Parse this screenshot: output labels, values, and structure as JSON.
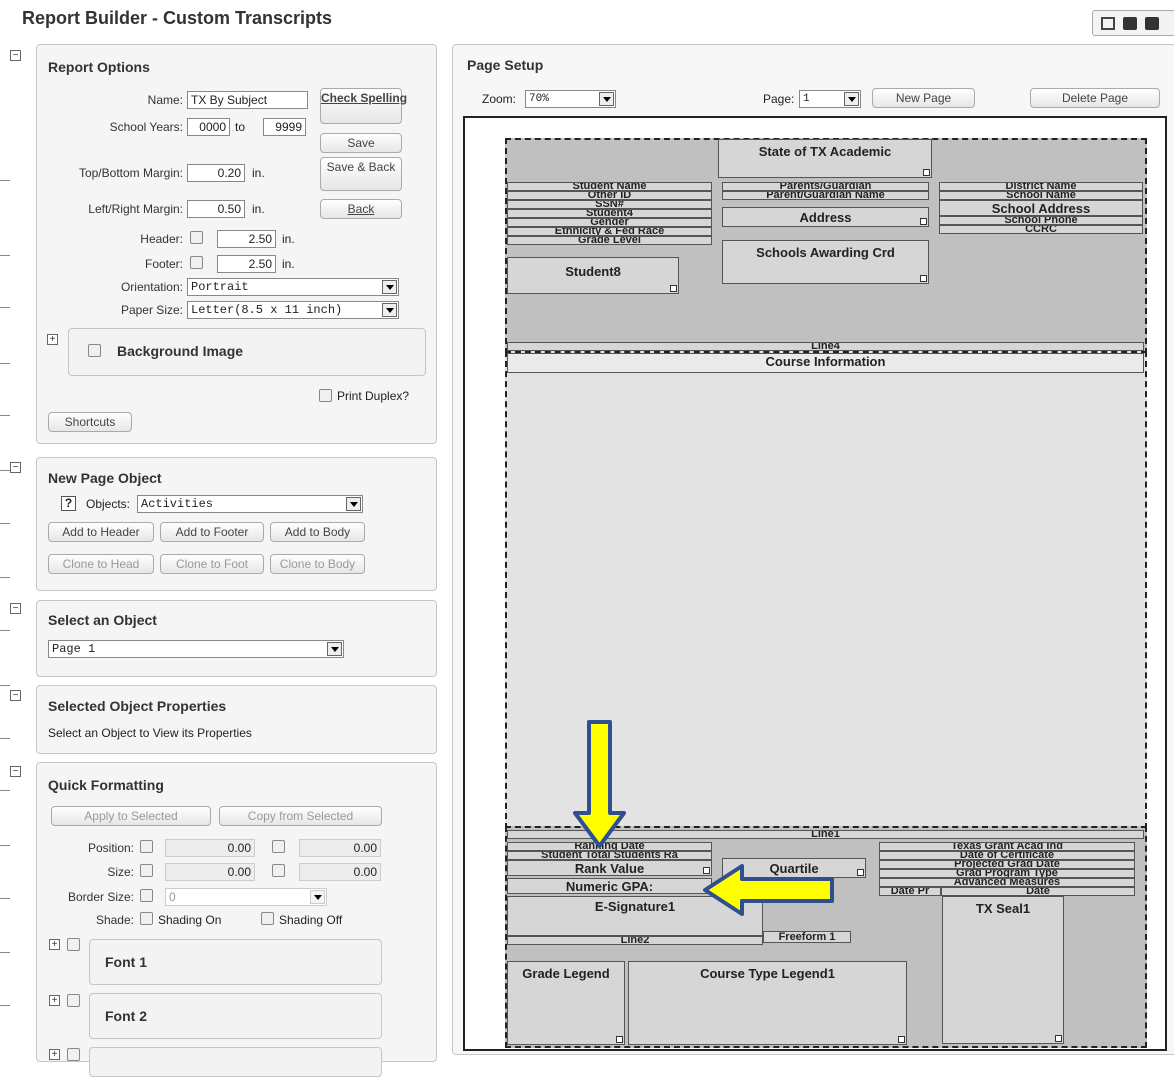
{
  "app": {
    "title": "Report Builder - Custom Transcripts"
  },
  "report_options": {
    "heading": "Report Options",
    "name_label": "Name:",
    "name_value": "TX By Subject",
    "check_spelling": "Check Spelling",
    "school_years_label": "School Years:",
    "year_from": "0000",
    "to_label": "to",
    "year_to": "9999",
    "save": "Save",
    "save_back": "Save & Back",
    "back": "Back",
    "tb_margin_label": "Top/Bottom Margin:",
    "tb_margin": "0.20",
    "lr_margin_label": "Left/Right Margin:",
    "lr_margin": "0.50",
    "in": "in.",
    "header_label": "Header:",
    "header_value": "2.50",
    "footer_label": "Footer:",
    "footer_value": "2.50",
    "orientation_label": "Orientation:",
    "orientation": "Portrait",
    "paper_label": "Paper Size:",
    "paper": "Letter(8.5 x 11 inch)",
    "background_image": "Background Image",
    "print_duplex": "Print Duplex?",
    "shortcuts": "Shortcuts"
  },
  "new_object": {
    "heading": "New Page Object",
    "help": "?",
    "objects_label": "Objects:",
    "objects_value": "Activities",
    "add_header": "Add to Header",
    "add_footer": "Add to Footer",
    "add_body": "Add to Body",
    "clone_head": "Clone to Head",
    "clone_foot": "Clone to Foot",
    "clone_body": "Clone to Body"
  },
  "select_object": {
    "heading": "Select an Object",
    "value": "Page 1"
  },
  "selected_props": {
    "heading": "Selected Object Properties",
    "text": "Select an Object to View its Properties"
  },
  "quick_format": {
    "heading": "Quick Formatting",
    "apply": "Apply to Selected",
    "copy": "Copy from Selected",
    "position_label": "Position:",
    "size_label": "Size:",
    "zero": "0.00",
    "border_label": "Border Size:",
    "border_value": "0",
    "shade_label": "Shade:",
    "shading_on": "Shading On",
    "shading_off": "Shading Off",
    "font1": "Font 1",
    "font2": "Font 2"
  },
  "page_setup": {
    "heading": "Page Setup",
    "zoom_label": "Zoom:",
    "zoom": "70%",
    "page_label": "Page:",
    "page": "1",
    "new_page": "New Page",
    "delete_page": "Delete Page"
  },
  "canvas": {
    "state": "State of TX Academic",
    "student_name": "Student Name",
    "other_id": "Other ID",
    "ssn": "SSN#",
    "student4": "Student4",
    "gender": "Gender",
    "ethnicity": "Ethnicity & Fed Race",
    "grade_level": "Grade Level",
    "parents": "Parents/Guardian",
    "parent_name": "Parent/Guardian Name",
    "address": "Address",
    "district": "District Name",
    "school_name": "School Name",
    "school_address": "School Address",
    "school_phone": "School Phone",
    "ccrc": "CCRC",
    "schools_awarding": "Schools Awarding Crd",
    "student8": "Student8",
    "line4": "Line4",
    "course_info": "Course Information",
    "line1": "Line1",
    "ranking_date": "Ranking Date",
    "total_students": "Student Total Students Ra",
    "rank_value": "Rank Value",
    "quartile": "Quartile",
    "numeric_gpa": "Numeric GPA:",
    "texas_grant": "Texas Grant Acad Ind",
    "date_cert": "Date of Certificate",
    "proj_grad": "Projected Grad Date",
    "grad_program": "Grad Program Type",
    "advanced": "Advanced Measures",
    "date_pr": "Date Pr",
    "date2": "Date",
    "esig": "E-Signature1",
    "line2": "Line2",
    "freeform": "Freeform 1",
    "tx_seal": "TX Seal1",
    "grade_legend": "Grade Legend",
    "course_type": "Course Type Legend1"
  },
  "colors": {
    "arrow_fill": "#ffff00",
    "arrow_stroke": "#2f4f8f",
    "section_bg": "#c0c0c0"
  }
}
